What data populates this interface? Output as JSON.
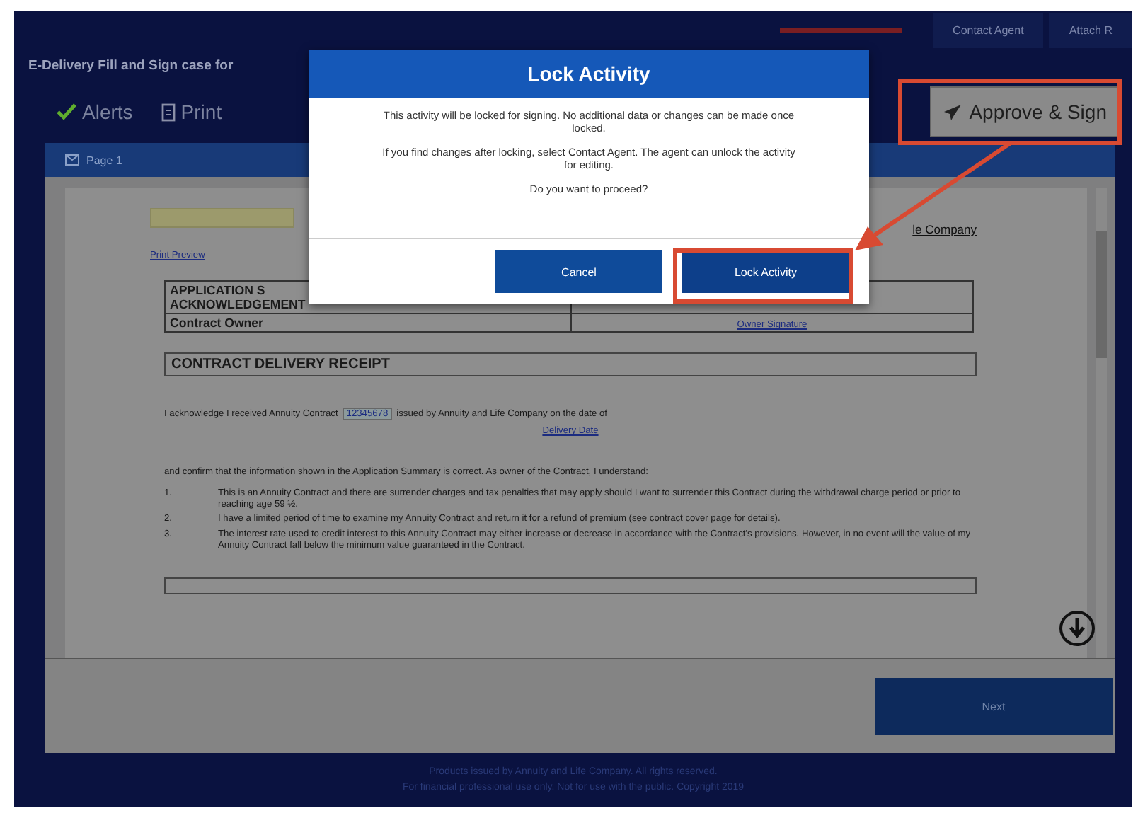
{
  "top_nav": [
    {
      "label": "Contact Agent"
    },
    {
      "label": "Attach R"
    }
  ],
  "title": "E-Delivery Fill and Sign case for",
  "toolbar": {
    "alerts": "Alerts",
    "print": "Print",
    "approve": "Approve & Sign"
  },
  "panel": {
    "title": "Page 1"
  },
  "document": {
    "field_link": "Print Preview",
    "company_link": "le Company",
    "table": [
      {
        "label_lines": [
          "APPLICATION S",
          "ACKNOWLEDGEMENT"
        ]
      },
      {
        "label_lines": [
          "Contract Owner"
        ],
        "value": "Owner Signature"
      }
    ],
    "section": "CONTRACT DELIVERY RECEIPT",
    "para_start": "I acknowledge I received Annuity Contract",
    "para_field": "12345678",
    "para_end": "issued by Annuity and Life Company on the date of",
    "date_link": "Delivery Date",
    "para2": "and confirm that the information shown in the Application Summary is correct. As owner of the Contract, I understand:",
    "items": [
      {
        "num": "1.",
        "text": "This is an Annuity Contract and there are surrender charges and tax penalties that may apply should I want to surrender this Contract during the withdrawal charge period or prior to reaching age 59 ½."
      },
      {
        "num": "2.",
        "text": "I have a limited period of time to examine my Annuity Contract and return it for a refund of premium (see contract cover page for details)."
      },
      {
        "num": "3.",
        "text": "The interest rate used to credit interest to this Annuity Contract may either increase or decrease in accordance with the Contract's provisions. However, in no event will the value of my Annuity Contract fall below the minimum value guaranteed in the Contract."
      }
    ]
  },
  "next_button": "Next",
  "footer": [
    "Products issued by Annuity and Life Company. All rights reserved.",
    "For financial professional use only. Not for use with the public. Copyright 2019"
  ],
  "dialog": {
    "title": "Lock Activity",
    "paragraphs": [
      "This activity will be locked for signing. No additional data or changes can be made once locked.",
      "If you find changes after locking, select Contact Agent. The agent can unlock the activity for editing.",
      "Do you want to proceed?"
    ],
    "buttons": [
      {
        "label": "Cancel",
        "kind": "secondary"
      },
      {
        "label": "Lock Activity",
        "kind": "primary"
      }
    ]
  }
}
